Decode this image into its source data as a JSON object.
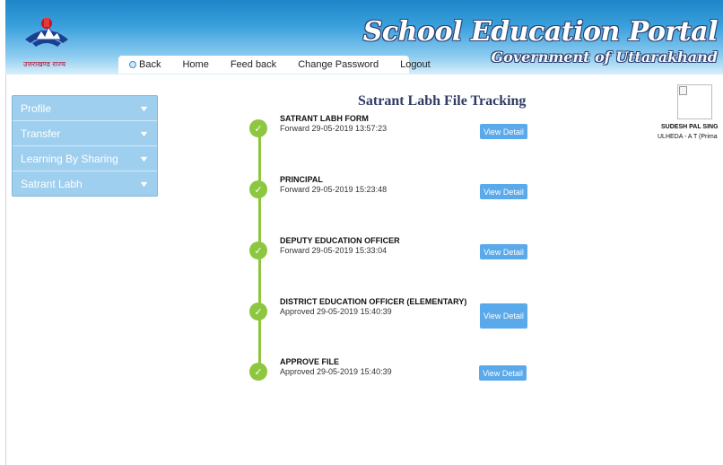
{
  "header": {
    "logo_text": "उत्तराखण्ड राज्य",
    "title": "School Education Portal",
    "subtitle": "Government of Uttarakhand"
  },
  "nav": {
    "back": "Back",
    "home": "Home",
    "feedback": "Feed back",
    "change_password": "Change Password",
    "logout": "Logout"
  },
  "sidebar": {
    "items": [
      {
        "label": "Profile"
      },
      {
        "label": "Transfer"
      },
      {
        "label": "Learning By Sharing"
      },
      {
        "label": "Satrant Labh"
      }
    ]
  },
  "page": {
    "title": "Satrant Labh File Tracking"
  },
  "timeline": [
    {
      "title": "SATRANT LABH FORM",
      "status": "Forward 29-05-2019 13:57:23",
      "button": "View Detail"
    },
    {
      "title": "PRINCIPAL",
      "status": "Forward 29-05-2019 15:23:48",
      "button": "View Detail"
    },
    {
      "title": "DEPUTY EDUCATION OFFICER",
      "status": "Forward 29-05-2019 15:33:04",
      "button": "View Detail"
    },
    {
      "title": "DISTRICT EDUCATION OFFICER (ELEMENTARY)",
      "status": "Approved 29-05-2019 15:40:39",
      "button": "View Detail"
    },
    {
      "title": "APPROVE FILE",
      "status": "Approved 29-05-2019 15:40:39",
      "button": "View Detail"
    }
  ],
  "user": {
    "name": "SUDESH PAL SING",
    "unit": "ULHEDA - A T (Prima"
  },
  "colors": {
    "accent": "#5aa9ea",
    "timeline": "#8dc63f",
    "sidebar": "#9fcfee",
    "title": "#2f3b63"
  },
  "icons": {
    "step": "check-icon",
    "menu": "chevron-down-icon",
    "back": "back-circle-icon",
    "photo": "broken-image-icon"
  }
}
